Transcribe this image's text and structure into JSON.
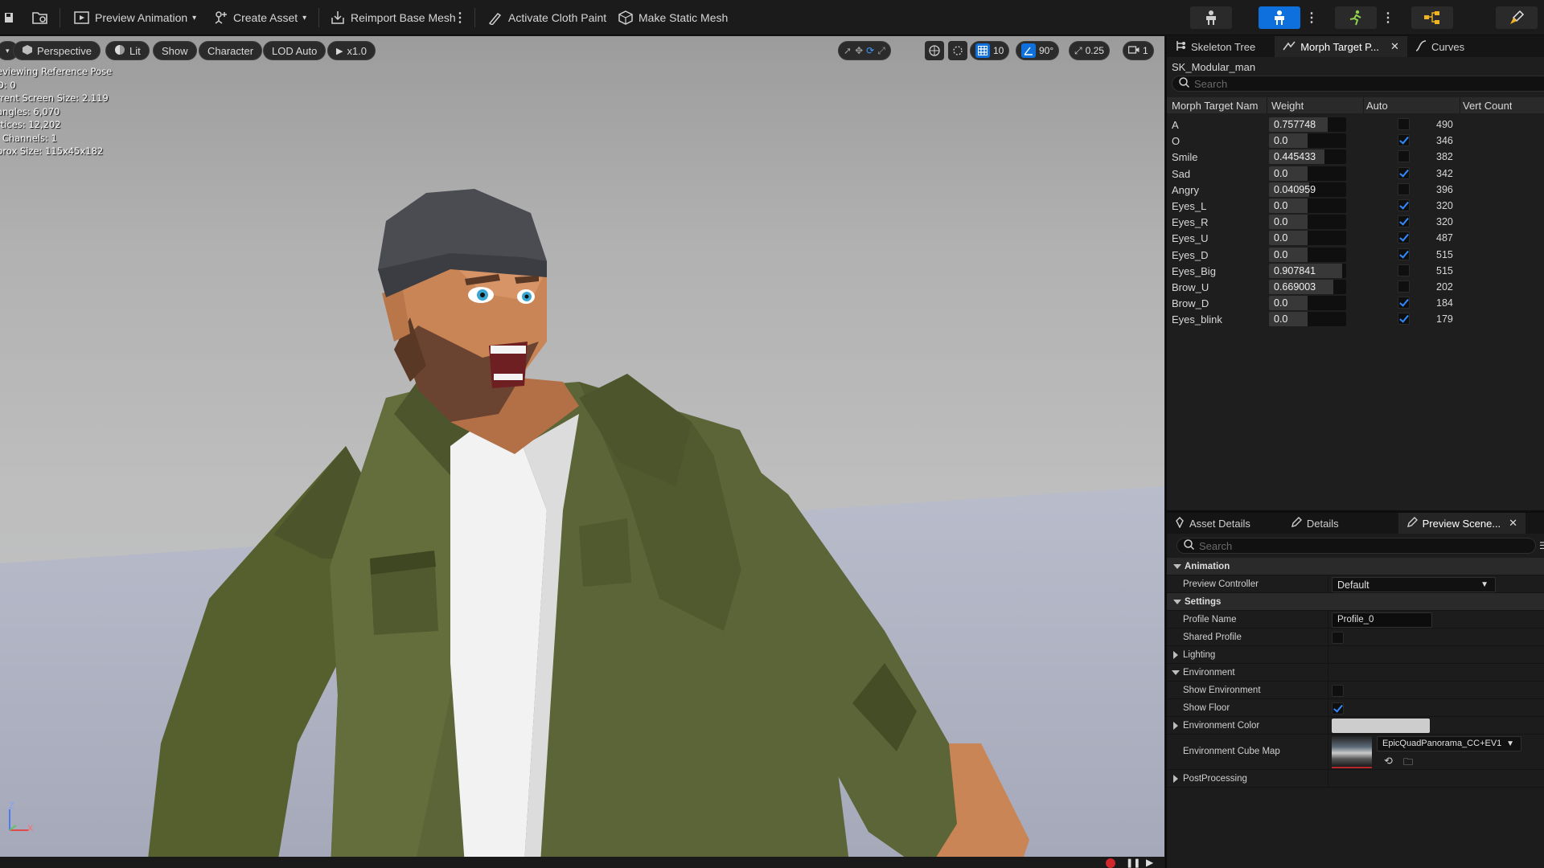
{
  "toolbar": {
    "preview_animation": "Preview Animation",
    "create_asset": "Create Asset",
    "reimport_base_mesh": "Reimport Base Mesh",
    "activate_cloth_paint": "Activate Cloth Paint",
    "make_static_mesh": "Make Static Mesh"
  },
  "viewport": {
    "perspective": "Perspective",
    "lit": "Lit",
    "show": "Show",
    "character": "Character",
    "lod": "LOD Auto",
    "play_rate": "x1.0",
    "grid_snap": "10",
    "rotation_snap": "90°",
    "scale_snap": "0.25",
    "camera_speed": "1",
    "info": [
      "eviewing Reference Pose",
      "D: 0",
      "rrent Screen Size: 2.119",
      "angles: 6,070",
      "rtices: 12,202",
      "' Channels: 1",
      "prox Size: 115x45x182"
    ],
    "axis_z": "Z",
    "axis_x": "X"
  },
  "top_tabs": {
    "skeleton_tree": "Skeleton Tree",
    "morph_target": "Morph Target P...",
    "curves": "Curves"
  },
  "mesh_name": "SK_Modular_man",
  "morph": {
    "search_placeholder": "Search",
    "headers": {
      "name": "Morph Target Nam",
      "weight": "Weight",
      "auto": "Auto",
      "vert": "Vert Count"
    },
    "rows": [
      {
        "name": "A",
        "weight": "0.757748",
        "fraction": 0.757748,
        "auto": false,
        "verts": "490"
      },
      {
        "name": "O",
        "weight": "0.0",
        "fraction": 0.5,
        "auto": true,
        "verts": "346"
      },
      {
        "name": "Smile",
        "weight": "0.445433",
        "fraction": 0.72,
        "auto": false,
        "verts": "382"
      },
      {
        "name": "Sad",
        "weight": "0.0",
        "fraction": 0.5,
        "auto": true,
        "verts": "342"
      },
      {
        "name": "Angry",
        "weight": "0.040959",
        "fraction": 0.52,
        "auto": false,
        "verts": "396"
      },
      {
        "name": "Eyes_L",
        "weight": "0.0",
        "fraction": 0.5,
        "auto": true,
        "verts": "320"
      },
      {
        "name": "Eyes_R",
        "weight": "0.0",
        "fraction": 0.5,
        "auto": true,
        "verts": "320"
      },
      {
        "name": "Eyes_U",
        "weight": "0.0",
        "fraction": 0.5,
        "auto": true,
        "verts": "487"
      },
      {
        "name": "Eyes_D",
        "weight": "0.0",
        "fraction": 0.5,
        "auto": true,
        "verts": "515"
      },
      {
        "name": "Eyes_Big",
        "weight": "0.907841",
        "fraction": 0.95,
        "auto": false,
        "verts": "515"
      },
      {
        "name": "Brow_U",
        "weight": "0.669003",
        "fraction": 0.83,
        "auto": false,
        "verts": "202"
      },
      {
        "name": "Brow_D",
        "weight": "0.0",
        "fraction": 0.5,
        "auto": true,
        "verts": "184"
      },
      {
        "name": "Eyes_blink",
        "weight": "0.0",
        "fraction": 0.5,
        "auto": true,
        "verts": "179"
      }
    ]
  },
  "bottom_tabs": {
    "asset_details": "Asset Details",
    "details": "Details",
    "preview_scene": "Preview Scene..."
  },
  "details": {
    "search_placeholder": "Search",
    "animation": "Animation",
    "preview_controller": "Preview Controller",
    "preview_controller_value": "Default",
    "settings": "Settings",
    "profile_name": "Profile Name",
    "profile_name_value": "Profile_0",
    "shared_profile": "Shared Profile",
    "lighting": "Lighting",
    "environment": "Environment",
    "show_environment": "Show Environment",
    "show_floor": "Show Floor",
    "environment_color": "Environment Color",
    "environment_cube_map": "Environment Cube Map",
    "cube_map_value": "EpicQuadPanorama_CC+EV1",
    "post_processing": "PostProcessing",
    "show_environment_checked": false,
    "show_floor_checked": true,
    "shared_profile_checked": false
  },
  "colors": {
    "accent": "#0e70dd",
    "check": "#2f8bff",
    "jacket": "#5b6537",
    "skin": "#c98556",
    "beanie": "#4a4c52"
  }
}
